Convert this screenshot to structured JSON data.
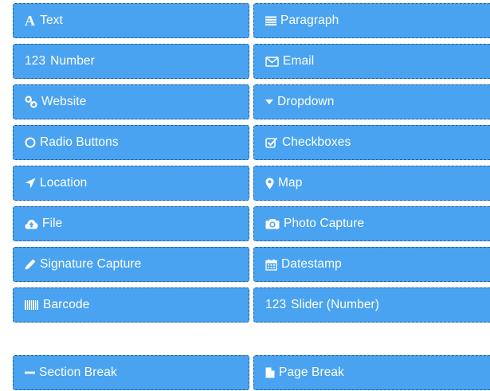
{
  "palette": {
    "tiles": [
      {
        "label": "Text",
        "icon": "text-icon"
      },
      {
        "label": "Paragraph",
        "icon": "paragraph-icon"
      },
      {
        "label": "Number",
        "icon": "number-icon",
        "icon_text": "123"
      },
      {
        "label": "Email",
        "icon": "envelope-icon"
      },
      {
        "label": "Website",
        "icon": "link-icon"
      },
      {
        "label": "Dropdown",
        "icon": "caret-down-icon"
      },
      {
        "label": "Radio Buttons",
        "icon": "radio-circle-icon"
      },
      {
        "label": "Checkboxes",
        "icon": "checkbox-icon"
      },
      {
        "label": "Location",
        "icon": "location-arrow-icon"
      },
      {
        "label": "Map",
        "icon": "map-marker-icon"
      },
      {
        "label": "File",
        "icon": "cloud-upload-icon"
      },
      {
        "label": "Photo Capture",
        "icon": "camera-icon"
      },
      {
        "label": "Signature Capture",
        "icon": "pencil-icon"
      },
      {
        "label": "Datestamp",
        "icon": "calendar-icon"
      },
      {
        "label": "Barcode",
        "icon": "barcode-icon"
      },
      {
        "label": "Slider (Number)",
        "icon": "slider-number-icon",
        "icon_text": "123"
      },
      {
        "label": "Section Break",
        "icon": "minus-icon"
      },
      {
        "label": "Page Break",
        "icon": "page-icon"
      }
    ],
    "colors": {
      "tile_background": "#4aa3f0",
      "tile_border": "#1d5f9c",
      "tile_text": "#ffffff"
    }
  }
}
